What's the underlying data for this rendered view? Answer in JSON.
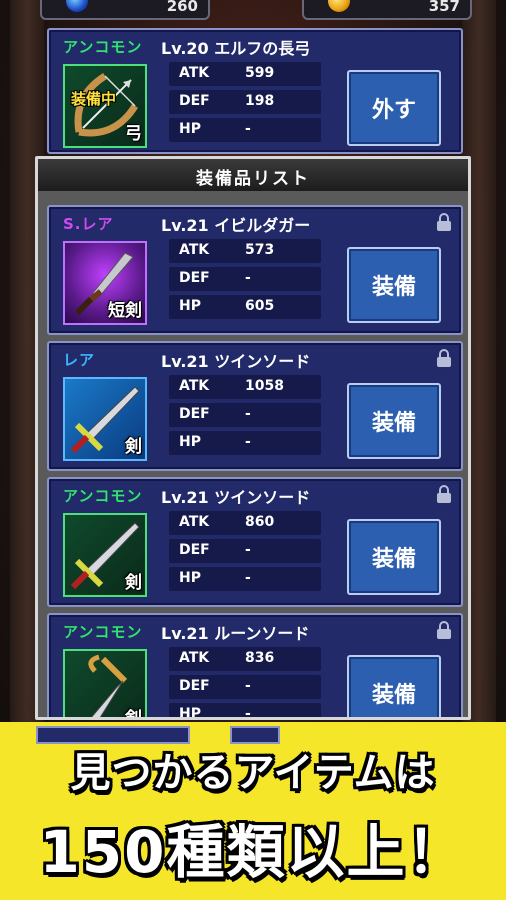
{
  "currency": {
    "gems": "260",
    "coins": "357"
  },
  "equipped": {
    "rarity": "アンコモン",
    "rarity_color": "#2fe66a",
    "title": "Lv.20 エルフの長弓",
    "weapon_type": "弓",
    "equipped_label": "装備中",
    "stats": [
      {
        "key": "ATK",
        "value": "599"
      },
      {
        "key": "DEF",
        "value": "198"
      },
      {
        "key": "HP",
        "value": "-"
      }
    ],
    "button": "外す"
  },
  "list": {
    "header": "装備品リスト",
    "items": [
      {
        "rarity": "S.レア",
        "rarity_color": "#d04bf0",
        "title": "Lv.21 イビルダガー",
        "weapon_type": "短剣",
        "stats": [
          {
            "key": "ATK",
            "value": "573"
          },
          {
            "key": "DEF",
            "value": "-"
          },
          {
            "key": "HP",
            "value": "605"
          }
        ],
        "button": "装備"
      },
      {
        "rarity": "レア",
        "rarity_color": "#3ab8ff",
        "title": "Lv.21 ツインソード",
        "weapon_type": "剣",
        "stats": [
          {
            "key": "ATK",
            "value": "1058"
          },
          {
            "key": "DEF",
            "value": "-"
          },
          {
            "key": "HP",
            "value": "-"
          }
        ],
        "button": "装備"
      },
      {
        "rarity": "アンコモン",
        "rarity_color": "#2fe66a",
        "title": "Lv.21 ツインソード",
        "weapon_type": "剣",
        "stats": [
          {
            "key": "ATK",
            "value": "860"
          },
          {
            "key": "DEF",
            "value": "-"
          },
          {
            "key": "HP",
            "value": "-"
          }
        ],
        "button": "装備"
      },
      {
        "rarity": "アンコモン",
        "rarity_color": "#2fe66a",
        "title": "Lv.21 ルーンソード",
        "weapon_type": "剣",
        "stats": [
          {
            "key": "ATK",
            "value": "836"
          },
          {
            "key": "DEF",
            "value": "-"
          },
          {
            "key": "HP",
            "value": "-"
          }
        ],
        "button": "装備"
      }
    ]
  },
  "banner": {
    "line1": "見つかるアイテムは",
    "line2": "150種類以上！"
  }
}
